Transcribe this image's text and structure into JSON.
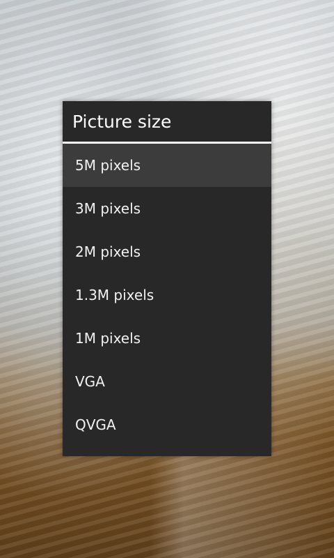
{
  "dialog": {
    "title": "Picture size",
    "options": [
      {
        "label": "5M pixels",
        "selected": true
      },
      {
        "label": "3M pixels",
        "selected": false
      },
      {
        "label": "2M pixels",
        "selected": false
      },
      {
        "label": "1.3M pixels",
        "selected": false
      },
      {
        "label": "1M pixels",
        "selected": false
      },
      {
        "label": "VGA",
        "selected": false
      },
      {
        "label": "QVGA",
        "selected": false
      }
    ]
  },
  "colors": {
    "dialog_background": "#282828",
    "selected_background": "#3c3c3c",
    "text": "#ffffff",
    "divider": "#ffffff"
  }
}
